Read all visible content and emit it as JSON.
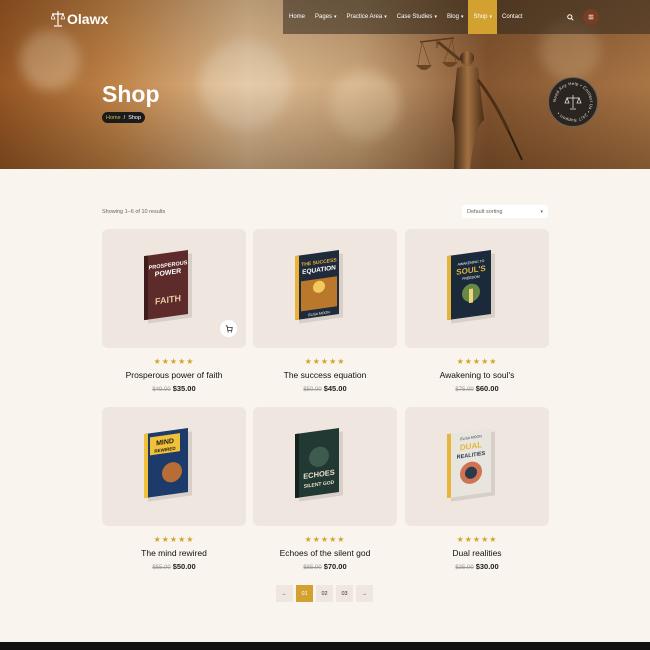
{
  "brand": {
    "name": "Olawx"
  },
  "nav": {
    "items": [
      {
        "label": "Home",
        "caret": false
      },
      {
        "label": "Pages",
        "caret": true
      },
      {
        "label": "Practice Area",
        "caret": true
      },
      {
        "label": "Case Studies",
        "caret": true
      },
      {
        "label": "Blog",
        "caret": true
      },
      {
        "label": "Shop",
        "caret": true,
        "active": true
      },
      {
        "label": "Contact",
        "caret": false
      }
    ],
    "search_icon": "search-icon",
    "menu_icon": "hamburger-icon"
  },
  "hero": {
    "title": "Shop",
    "breadcrumb": {
      "home": "Home",
      "separator": "/",
      "current": "Shop"
    },
    "seal_text": "Need Any Help • Contact Us • 24/7 Support •"
  },
  "toolbar": {
    "results": "Showing 1–6 of 10 results",
    "sort": "Default sorting"
  },
  "products": [
    {
      "name": "Prosperous power of faith",
      "old_price": "$49.00",
      "price": "$35.00",
      "rating": 5,
      "book_title": "PROSPEROUS POWER",
      "book_sub": "FAITH",
      "cover": "#5c2b2a",
      "accent": "#e9c7a3"
    },
    {
      "name": "The success equation",
      "old_price": "$50.00",
      "price": "$45.00",
      "rating": 5,
      "book_title": "THE SUCCESS EQUATION",
      "book_sub": "ELISA MOON",
      "cover": "#1f2a3a",
      "accent": "#e9b23a"
    },
    {
      "name": "Awakening to soul's",
      "old_price": "$75.00",
      "price": "$60.00",
      "rating": 5,
      "book_title": "SOUL'S",
      "book_sub": "FREEDOM",
      "cover": "#1a2a3a",
      "accent": "#e2b33d"
    },
    {
      "name": "The mind rewired",
      "old_price": "$55.00",
      "price": "$50.00",
      "rating": 5,
      "book_title": "MIND REWIRED",
      "book_sub": "",
      "cover": "#1c3a6a",
      "accent": "#f0c23a"
    },
    {
      "name": "Echoes of the silent god",
      "old_price": "$85.00",
      "price": "$70.00",
      "rating": 5,
      "book_title": "ECHOES",
      "book_sub": "SILENT GOD",
      "cover": "#223832",
      "accent": "#e8e0c8"
    },
    {
      "name": "Dual realities",
      "old_price": "$35.00",
      "price": "$30.00",
      "rating": 5,
      "book_title": "DUAL REALITIES",
      "book_sub": "ELISA MOON",
      "cover": "#2a3a4a",
      "accent": "#e6b53a"
    }
  ],
  "pagination": {
    "prev": "←",
    "pages": [
      "01",
      "02",
      "03"
    ],
    "current": "01",
    "next": "→"
  }
}
